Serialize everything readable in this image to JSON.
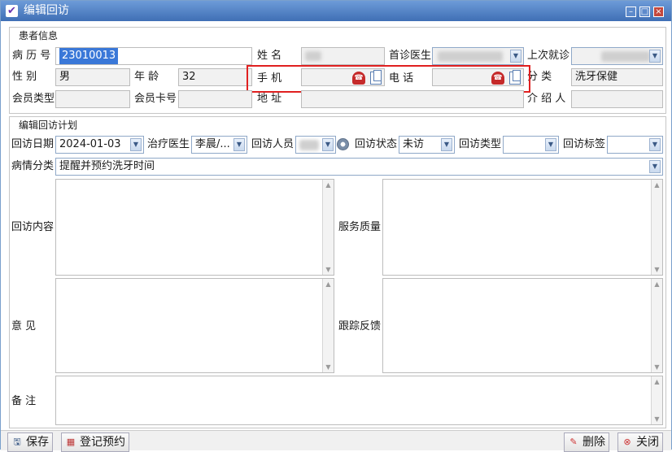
{
  "window": {
    "title": "编辑回访"
  },
  "patient": {
    "section_title": "患者信息",
    "record_no_label": "病 历 号",
    "record_no": "23010013",
    "name_label": "姓    名",
    "first_doctor_label": "首诊医生",
    "last_visit_label": "上次就诊",
    "gender_label": "性    别",
    "gender": "男",
    "age_label": "年    龄",
    "age": "32",
    "mobile_label": "手    机",
    "phone_label": "电    话",
    "category_label": "分    类",
    "category": "洗牙保健",
    "member_type_label": "会员类型",
    "member_card_label": "会员卡号",
    "address_label": "地    址",
    "referrer_label": "介 绍 人"
  },
  "plan": {
    "section_title": "编辑回访计划",
    "date_label": "回访日期",
    "date": "2024-01-03",
    "doctor_label": "治疗医生",
    "doctor": "李晨/...",
    "staff_label": "回访人员",
    "status_label": "回访状态",
    "status": "未访",
    "type_label": "回访类型",
    "type": "",
    "tag_label": "回访标签",
    "tag": "",
    "condition_label": "病情分类",
    "condition": "提醒并预约洗牙时间",
    "content_label": "回访内容",
    "quality_label": "服务质量",
    "opinion_label": "意    见",
    "feedback_label": "跟踪反馈",
    "remark_label": "备    注"
  },
  "buttons": {
    "save": "保存",
    "register": "登记预约",
    "delete": "删除",
    "close": "关闭"
  },
  "colors": {
    "titlebar": "#3f6fb5",
    "highlight_box": "#e02020",
    "selection": "#3a78d8"
  }
}
